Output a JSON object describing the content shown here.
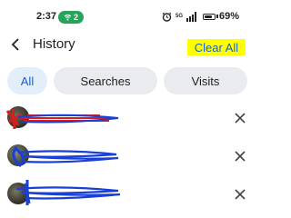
{
  "status_bar": {
    "time": "2:37",
    "hotspot_count": "2",
    "network_label": "5G",
    "battery_percent": "69%",
    "battery_level": 0.69
  },
  "header": {
    "title": "History",
    "clear_all_label": "Clear All"
  },
  "tabs": [
    {
      "label": "All",
      "active": true
    },
    {
      "label": "Searches",
      "active": false
    },
    {
      "label": "Visits",
      "active": false
    }
  ],
  "history_items": [
    {
      "text": "",
      "scribble_color": "#d21f1f"
    },
    {
      "text": "",
      "scribble_color": "#1a3fd6"
    },
    {
      "text": "",
      "scribble_color": "#1a3fd6"
    }
  ],
  "colors": {
    "accent": "#1a5fd0",
    "highlight": "#ffff00",
    "hotspot_green": "#25a45a",
    "tab_bg": "#e9ebee",
    "tab_active_bg": "#e3eefb"
  },
  "icons": {
    "back": "chevron-left-icon",
    "remove": "close-icon",
    "alarm": "alarm-icon",
    "signal": "signal-icon",
    "battery": "battery-icon"
  }
}
